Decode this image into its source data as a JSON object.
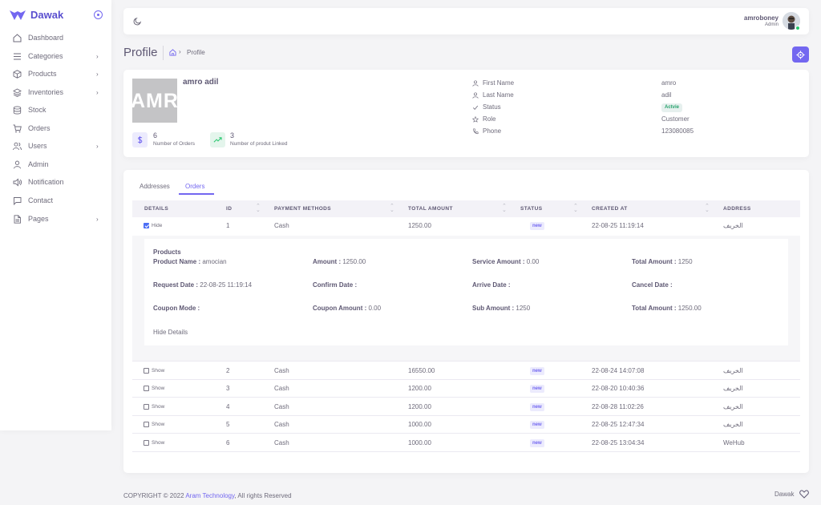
{
  "sidebar": {
    "brand": "Dawak",
    "items": [
      {
        "label": "Dashboard",
        "icon": "home-icon",
        "has_children": false
      },
      {
        "label": "Categories",
        "icon": "list-icon",
        "has_children": true
      },
      {
        "label": "Products",
        "icon": "package-icon",
        "has_children": true
      },
      {
        "label": "Inventories",
        "icon": "layers-icon",
        "has_children": true
      },
      {
        "label": "Stock",
        "icon": "database-icon",
        "has_children": false
      },
      {
        "label": "Orders",
        "icon": "cart-icon",
        "has_children": false
      },
      {
        "label": "Users",
        "icon": "users-icon",
        "has_children": true
      },
      {
        "label": "Admin",
        "icon": "user-icon",
        "has_children": false
      },
      {
        "label": "Notification",
        "icon": "speaker-icon",
        "has_children": false
      },
      {
        "label": "Contact",
        "icon": "message-icon",
        "has_children": false
      },
      {
        "label": "Pages",
        "icon": "file-icon",
        "has_children": true
      }
    ]
  },
  "topbar": {
    "user_name": "amroboney",
    "user_role": "Admin"
  },
  "header": {
    "title": "Profile",
    "breadcrumb_current": "Profile"
  },
  "profile": {
    "image_text": "AMRO",
    "name": "amro adil",
    "stats": [
      {
        "value": "6",
        "label": "Number of Orders"
      },
      {
        "value": "3",
        "label": "Number of produt Linked"
      }
    ],
    "info": [
      {
        "label": "First Name",
        "value": "amro",
        "icon": "user-icon"
      },
      {
        "label": "Last Name",
        "value": "adil",
        "icon": "user-icon"
      },
      {
        "label": "Status",
        "value": "Actvie",
        "icon": "check-icon"
      },
      {
        "label": "Role",
        "value": "Customer",
        "icon": "star-icon"
      },
      {
        "label": "Phone",
        "value": "123080085",
        "icon": "phone-icon"
      }
    ]
  },
  "orders": {
    "tabs": [
      "Addresses",
      "Orders"
    ],
    "active_tab": "Orders",
    "columns": [
      "DETAILS",
      "ID",
      "PAYMENT METHODS",
      "TOTAL AMOUNT",
      "STATUS",
      "CREATED AT",
      "ADDRESS"
    ],
    "rows": [
      {
        "toggle": "Hide",
        "checked": true,
        "id": "1",
        "payment": "Cash",
        "total": "1250.00",
        "status": "new",
        "created": "22-08-25 11:19:14",
        "address": "الخريف"
      },
      {
        "toggle": "Show",
        "checked": false,
        "id": "2",
        "payment": "Cash",
        "total": "16550.00",
        "status": "new",
        "created": "22-08-24 14:07:08",
        "address": "الخريف"
      },
      {
        "toggle": "Show",
        "checked": false,
        "id": "3",
        "payment": "Cash",
        "total": "1200.00",
        "status": "new",
        "created": "22-08-20 10:40:36",
        "address": "الخريف"
      },
      {
        "toggle": "Show",
        "checked": false,
        "id": "4",
        "payment": "Cash",
        "total": "1200.00",
        "status": "new",
        "created": "22-08-28 11:02:26",
        "address": "الخريف"
      },
      {
        "toggle": "Show",
        "checked": false,
        "id": "5",
        "payment": "Cash",
        "total": "1000.00",
        "status": "new",
        "created": "22-08-25 12:47:34",
        "address": "الخريف"
      },
      {
        "toggle": "Show",
        "checked": false,
        "id": "6",
        "payment": "Cash",
        "total": "1000.00",
        "status": "new",
        "created": "22-08-25 13:04:34",
        "address": "WeHub"
      }
    ],
    "details": {
      "heading": "Products",
      "fields": [
        {
          "label": "Product Name :",
          "value": " amocian"
        },
        {
          "label": "Amount :",
          "value": " 1250.00"
        },
        {
          "label": "Service Amount :",
          "value": " 0.00"
        },
        {
          "label": "Total Amount :",
          "value": " 1250"
        },
        {
          "label": "Request Date :",
          "value": " 22-08-25 11:19:14"
        },
        {
          "label": "Confirm Date :",
          "value": ""
        },
        {
          "label": "Arrive Date :",
          "value": ""
        },
        {
          "label": "Cancel Date :",
          "value": ""
        },
        {
          "label": "Coupon Mode :",
          "value": ""
        },
        {
          "label": "Coupon Amount :",
          "value": " 0.00"
        },
        {
          "label": "Sub Amount :",
          "value": " 1250"
        },
        {
          "label": "Total Amount :",
          "value": " 1250.00"
        }
      ],
      "hide_link": "Hide Details"
    }
  },
  "footer": {
    "copyright": "COPYRIGHT © 2022",
    "company": "Aram Technology",
    "rights": ", All rights Reserved",
    "brand": "Dawak"
  },
  "colors": {
    "primary": "#7367f0",
    "success": "#28c76f",
    "text": "#5e5873"
  }
}
